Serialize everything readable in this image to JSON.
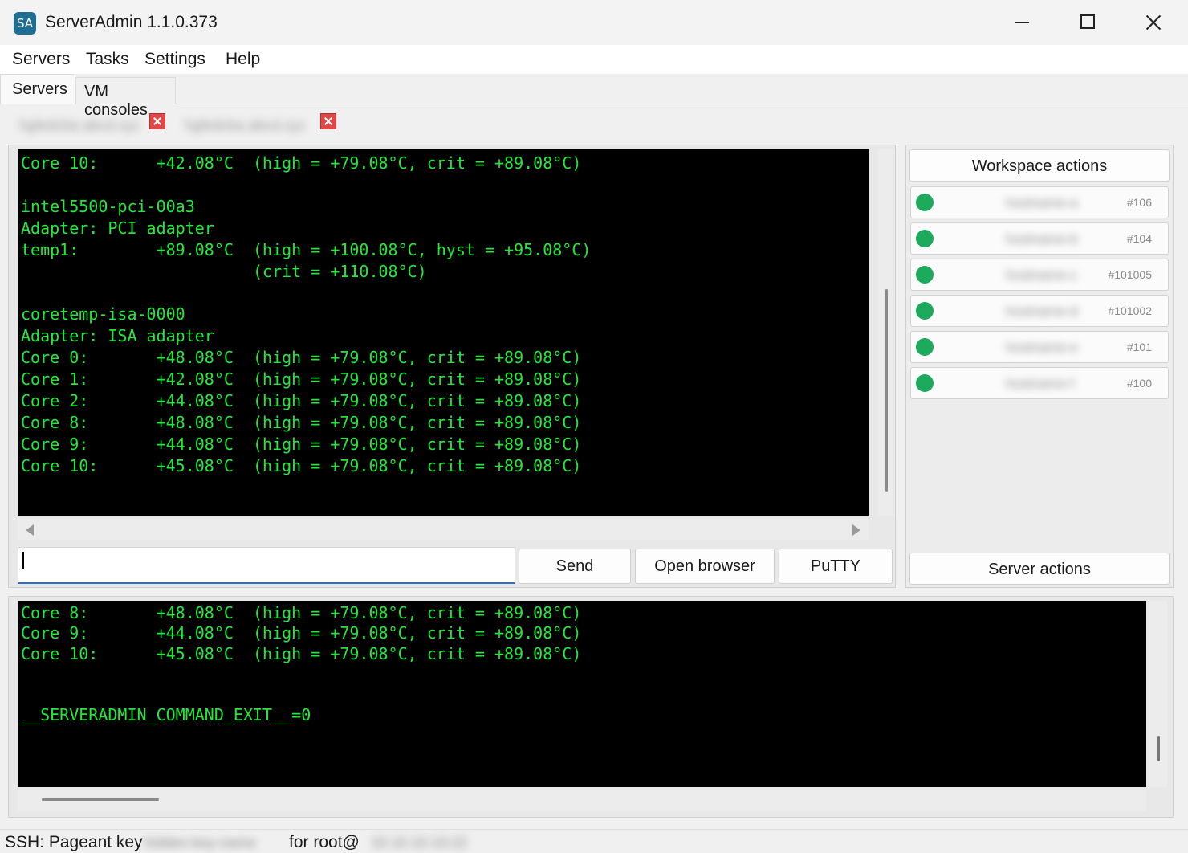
{
  "window": {
    "icon_text": "SA",
    "title": "ServerAdmin 1.1.0.373"
  },
  "menu": [
    "Servers",
    "Tasks",
    "Settings",
    "Help"
  ],
  "tabs": [
    {
      "label": "Servers",
      "active": true
    },
    {
      "label": "VM consoles",
      "active": false
    }
  ],
  "server_tabs": [
    {
      "label": "hgfedcba.abcd.xyz"
    },
    {
      "label": "hgfedcba.abcd.xyz"
    }
  ],
  "terminal_top": {
    "lines": [
      "Core 10:      +42.08°C  (high = +79.08°C, crit = +89.08°C)",
      "",
      "intel5500-pci-00a3",
      "Adapter: PCI adapter",
      "temp1:        +89.08°C  (high = +100.08°C, hyst = +95.08°C)",
      "                        (crit = +110.08°C)",
      "",
      "coretemp-isa-0000",
      "Adapter: ISA adapter",
      "Core 0:       +48.08°C  (high = +79.08°C, crit = +89.08°C)",
      "Core 1:       +42.08°C  (high = +79.08°C, crit = +89.08°C)",
      "Core 2:       +44.08°C  (high = +79.08°C, crit = +89.08°C)",
      "Core 8:       +48.08°C  (high = +79.08°C, crit = +89.08°C)",
      "Core 9:       +44.08°C  (high = +79.08°C, crit = +89.08°C)",
      "Core 10:      +45.08°C  (high = +79.08°C, crit = +89.08°C)"
    ]
  },
  "command_input": {
    "value": ""
  },
  "buttons": {
    "send": "Send",
    "open_browser": "Open browser",
    "putty": "PuTTY"
  },
  "workspace": {
    "header": "Workspace actions",
    "vms": [
      {
        "name": "hostname-a",
        "id": "#106",
        "status": "running"
      },
      {
        "name": "hostname-b",
        "id": "#104",
        "status": "running"
      },
      {
        "name": "hostname-c",
        "id": "#101005",
        "status": "running"
      },
      {
        "name": "hostname-d",
        "id": "#101002",
        "status": "running"
      },
      {
        "name": "hostname-e",
        "id": "#101",
        "status": "running"
      },
      {
        "name": "hostname-f",
        "id": "#100",
        "status": "running"
      }
    ],
    "server_actions": "Server actions"
  },
  "terminal_bottom": {
    "lines": [
      "Core 8:       +48.08°C  (high = +79.08°C, crit = +89.08°C)",
      "Core 9:       +44.08°C  (high = +79.08°C, crit = +89.08°C)",
      "Core 10:      +45.08°C  (high = +79.08°C, crit = +89.08°C)",
      "",
      "",
      "__SERVERADMIN_COMMAND_EXIT__=0"
    ]
  },
  "status": {
    "prefix": "SSH: Pageant key",
    "key_name": "hidden-key-name",
    "middle": "for root@",
    "host": "10.10.10.10:22"
  },
  "colors": {
    "terminal_text": "#22e83a",
    "terminal_bg": "#000000",
    "status_running": "#1eaa5c",
    "tab_close": "#e04848",
    "input_focus": "#2a6fc0"
  }
}
